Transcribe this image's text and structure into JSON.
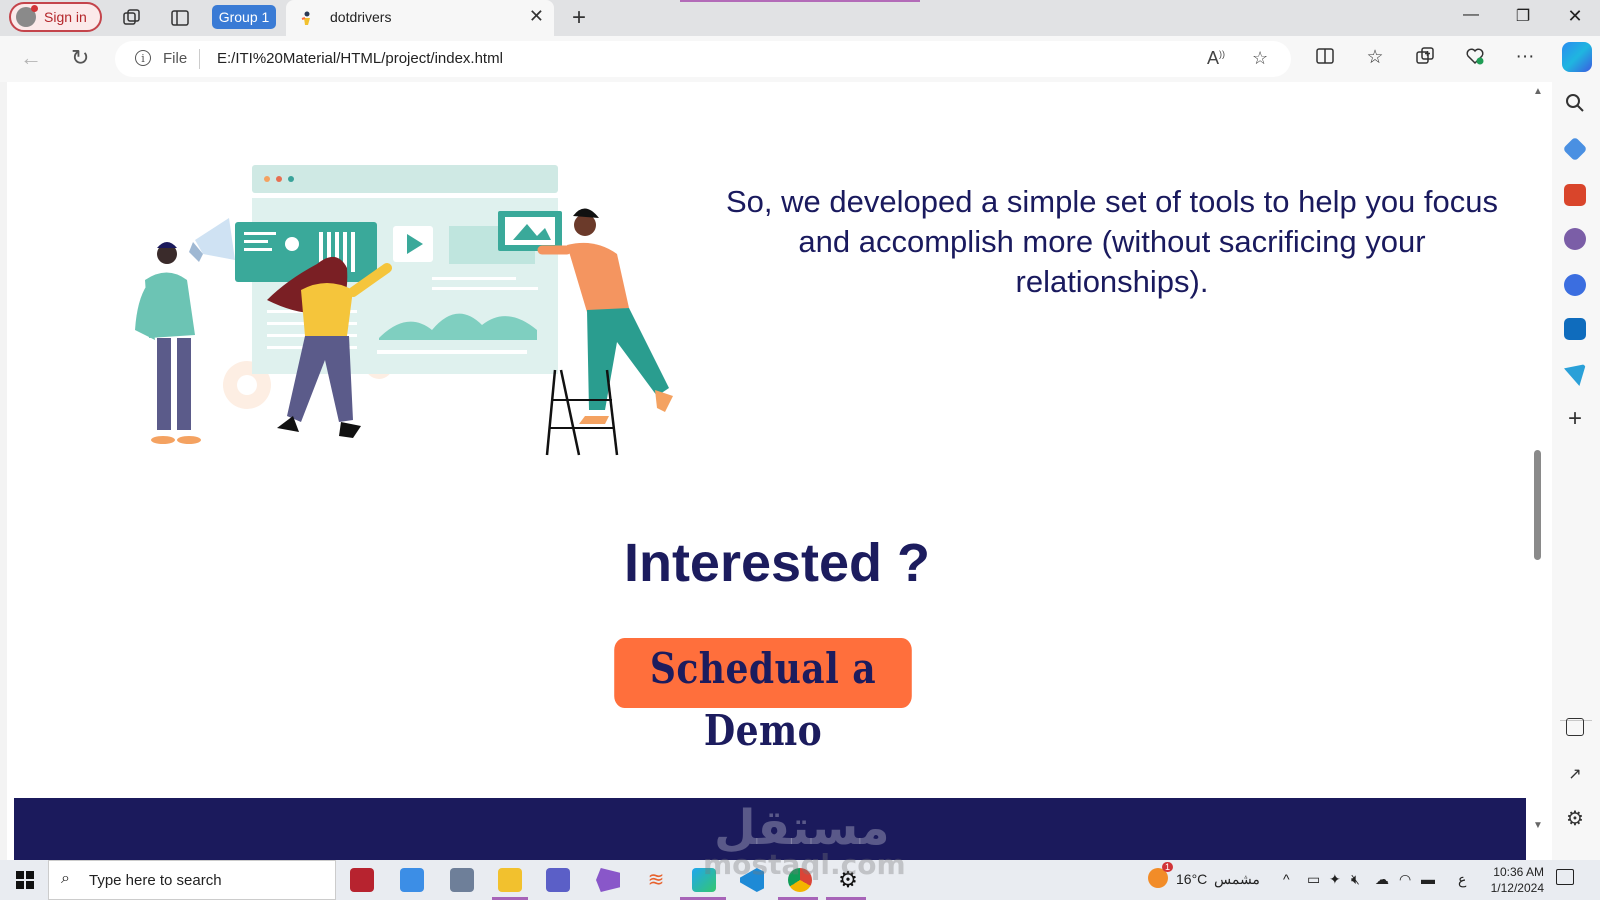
{
  "browser": {
    "sign_in_label": "Sign in",
    "group_label": "Group 1",
    "tab_title": "dotdrivers",
    "address": {
      "scheme_label": "File",
      "url": "E:/ITI%20Material/HTML/project/index.html"
    },
    "colors": {
      "accent": "#3a7bd5",
      "signin": "#c4444b"
    }
  },
  "page": {
    "tagline": "So, we developed a simple set of tools to help you focus and accomplish more (without sacrificing your relationships).",
    "cta_heading": "Interested ?",
    "cta_button": "Schedual a Demo",
    "footer_watermark": "مستقل",
    "colors": {
      "navy": "#1b1a5c",
      "orange": "#ff6f3c",
      "text": "#1a1a5e"
    }
  },
  "taskbar": {
    "search_placeholder": "Type here to search",
    "weather": "16°C",
    "weather_label": "مشمس",
    "weather_badge": "1",
    "lang": "ع",
    "time": "10:36 AM",
    "date": "1/12/2024"
  },
  "overlay": {
    "watermark": "mostaql.com"
  }
}
